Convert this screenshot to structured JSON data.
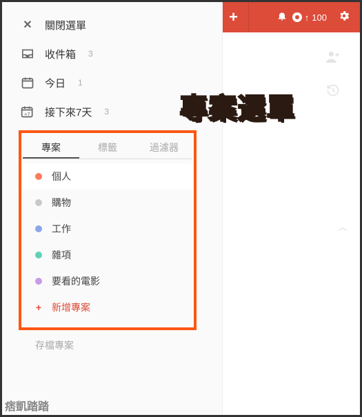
{
  "header": {
    "karma_score": "100"
  },
  "sidebar": {
    "close_label": "關閉選單",
    "inbox_label": "收件箱",
    "inbox_count": "3",
    "today_label": "今日",
    "today_count": "1",
    "next7_label": "接下來7天",
    "next7_count": "3"
  },
  "tabs": {
    "projects": "專案",
    "labels": "標籤",
    "filters": "過濾器"
  },
  "projects": [
    {
      "label": "個人",
      "color": "#ff7b5a",
      "active": true
    },
    {
      "label": "購物",
      "color": "#c8c8c8",
      "active": false
    },
    {
      "label": "工作",
      "color": "#8aa8e8",
      "active": false
    },
    {
      "label": "雜項",
      "color": "#5fd3b6",
      "active": false
    },
    {
      "label": "要看的電影",
      "color": "#c79be6",
      "active": false
    }
  ],
  "add_project_label": "新增專案",
  "archive_label": "存檔專案",
  "overlay_title": "專案選單",
  "watermark": "痞凱踏踏"
}
